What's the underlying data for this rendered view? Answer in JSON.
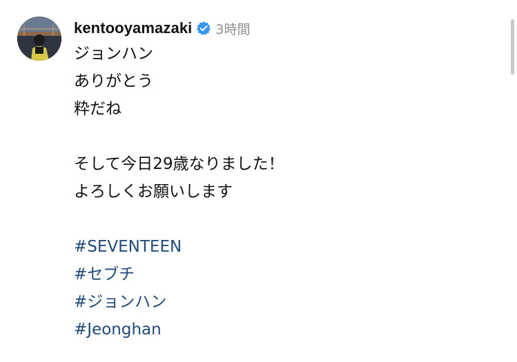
{
  "post": {
    "username": "kentooyamazaki",
    "verified": true,
    "timestamp": "3時間",
    "caption": {
      "lines": [
        "ジョンハン",
        "ありがとう",
        "粋だね"
      ],
      "lines2": [
        "そして今日29歳なりました！",
        "よろしくお願いします"
      ],
      "hashtags": [
        "#SEVENTEEN",
        "#セブチ",
        "#ジョンハン",
        "#Jeonghan"
      ]
    },
    "colors": {
      "hashtag": "#1f4a7a",
      "verified_badge": "#3897f0",
      "timestamp": "#8e8e93"
    },
    "icons": {
      "verified": "verified-badge-icon"
    }
  }
}
